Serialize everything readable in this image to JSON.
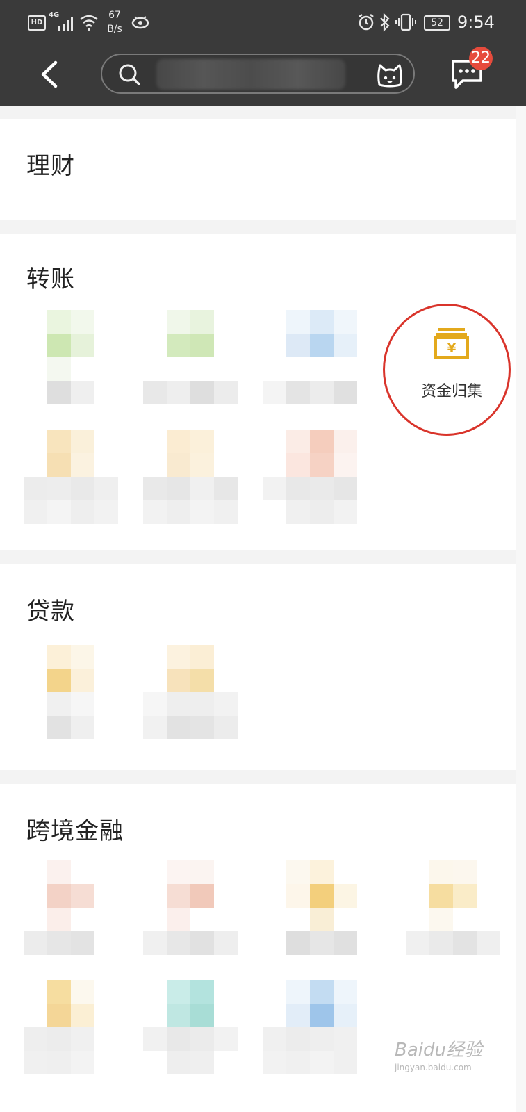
{
  "status_bar": {
    "hd": "HD",
    "network": "4G",
    "speed_value": "67",
    "speed_unit": "B/s",
    "battery": "52",
    "time": "9:54"
  },
  "header": {
    "search_placeholder": "",
    "message_badge_count": "22"
  },
  "sections": [
    {
      "title": "理财"
    },
    {
      "title": "转账"
    },
    {
      "title": "贷款"
    },
    {
      "title": "跨境金融"
    }
  ],
  "highlighted_item": {
    "label": "资金归集",
    "icon": "money-box-icon",
    "icon_color": "#e3a91c",
    "circle_color": "#d9342b"
  },
  "watermark": {
    "brand": "Baidu经验",
    "site": "jingyan.baidu.com"
  },
  "colors": {
    "topbar": "#3a3a3a",
    "badge": "#e64b3c"
  }
}
